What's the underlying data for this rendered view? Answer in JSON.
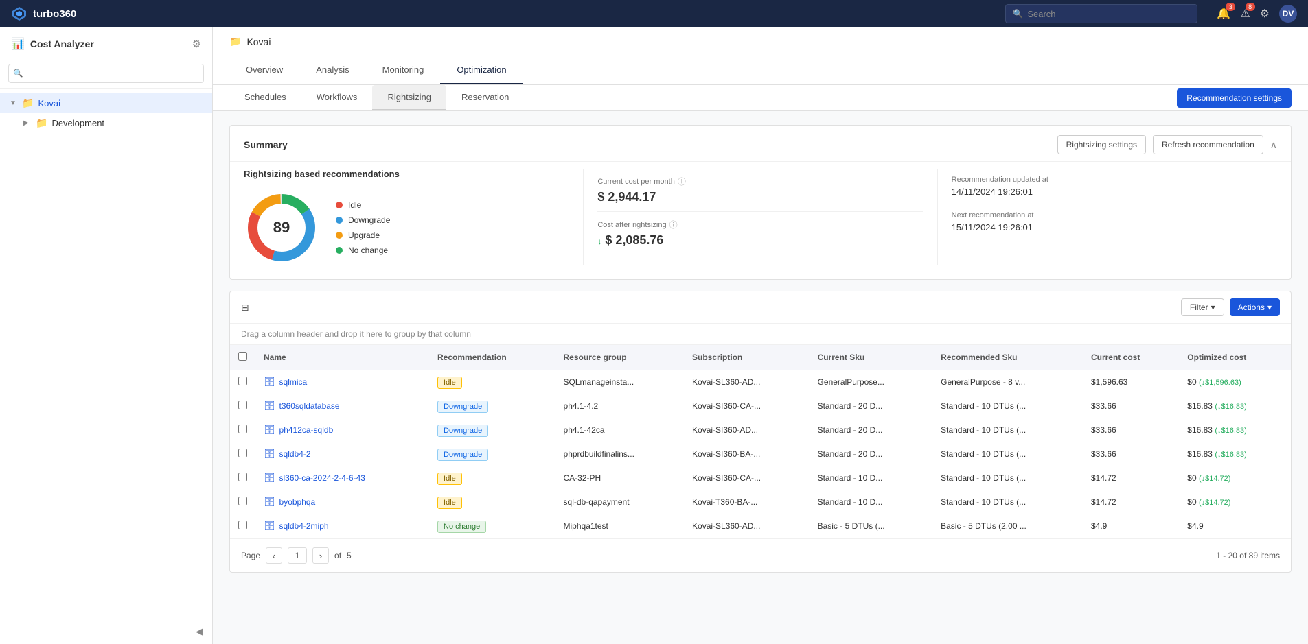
{
  "app": {
    "name": "turbo360",
    "logo_text": "turbo360"
  },
  "topnav": {
    "search_placeholder": "Search",
    "bell_badge": "8",
    "alert_badge": "3",
    "avatar_text": "DV"
  },
  "sidebar": {
    "title": "Cost Analyzer",
    "search_placeholder": "",
    "tree_items": [
      {
        "id": "kovai",
        "label": "Kovai",
        "level": 0,
        "active": true,
        "expanded": true
      },
      {
        "id": "development",
        "label": "Development",
        "level": 1,
        "active": false
      }
    ]
  },
  "page": {
    "breadcrumb": "Kovai",
    "tabs_primary": [
      {
        "id": "overview",
        "label": "Overview",
        "active": false
      },
      {
        "id": "analysis",
        "label": "Analysis",
        "active": false
      },
      {
        "id": "monitoring",
        "label": "Monitoring",
        "active": false
      },
      {
        "id": "optimization",
        "label": "Optimization",
        "active": true
      }
    ],
    "tabs_secondary": [
      {
        "id": "schedules",
        "label": "Schedules",
        "active": false
      },
      {
        "id": "workflows",
        "label": "Workflows",
        "active": false
      },
      {
        "id": "rightsizing",
        "label": "Rightsizing",
        "active": true
      },
      {
        "id": "reservation",
        "label": "Reservation",
        "active": false
      }
    ],
    "rec_settings_btn": "Recommendation settings"
  },
  "summary": {
    "title": "Summary",
    "btn_rightsizing": "Rightsizing settings",
    "btn_refresh": "Refresh recommendation",
    "chart": {
      "title": "Rightsizing based recommendations",
      "center_value": "89",
      "segments": [
        {
          "label": "Idle",
          "color": "#e74c3c",
          "value": 25
        },
        {
          "label": "Downgrade",
          "color": "#3498db",
          "value": 35
        },
        {
          "label": "Upgrade",
          "color": "#f39c12",
          "value": 15
        },
        {
          "label": "No change",
          "color": "#27ae60",
          "value": 14
        }
      ]
    },
    "stats": [
      {
        "label": "Current cost per month",
        "value": "$ 2,944.17",
        "arrow": "",
        "has_info": true
      },
      {
        "label": "Cost after rightsizing",
        "value": "$ 2,085.76",
        "arrow": "↓",
        "has_info": true
      }
    ],
    "rec_info": [
      {
        "label": "Recommendation updated at",
        "value": "14/11/2024 19:26:01"
      },
      {
        "label": "Next recommendation at",
        "value": "15/11/2024 19:26:01"
      }
    ]
  },
  "table": {
    "drag_hint": "Drag a column header and drop it here to group by that column",
    "filter_btn": "Filter",
    "actions_btn": "Actions",
    "columns": [
      "Name",
      "Recommendation",
      "Resource group",
      "Subscription",
      "Current Sku",
      "Recommended Sku",
      "Current cost",
      "Optimized cost"
    ],
    "rows": [
      {
        "name": "sqlmica",
        "recommendation": "Idle",
        "rec_type": "idle",
        "resource_group": "SQLmanageinsta...",
        "subscription": "Kovai-SL360-AD...",
        "current_sku": "GeneralPurpose...",
        "recommended_sku": "GeneralPurpose - 8 v...",
        "current_cost": "$1,596.63",
        "optimized_cost": "$0",
        "savings": "↓$1,596.63"
      },
      {
        "name": "t360sqldatabase",
        "recommendation": "Downgrade",
        "rec_type": "downgrade",
        "resource_group": "ph4.1-4.2",
        "subscription": "Kovai-SI360-CA-...",
        "current_sku": "Standard - 20 D...",
        "recommended_sku": "Standard - 10 DTUs (...",
        "current_cost": "$33.66",
        "optimized_cost": "$16.83",
        "savings": "↓$16.83"
      },
      {
        "name": "ph412ca-sqldb",
        "recommendation": "Downgrade",
        "rec_type": "downgrade",
        "resource_group": "ph4.1-42ca",
        "subscription": "Kovai-SI360-AD...",
        "current_sku": "Standard - 20 D...",
        "recommended_sku": "Standard - 10 DTUs (...",
        "current_cost": "$33.66",
        "optimized_cost": "$16.83",
        "savings": "↓$16.83"
      },
      {
        "name": "sqldb4-2",
        "recommendation": "Downgrade",
        "rec_type": "downgrade",
        "resource_group": "phprdbuildfinalins...",
        "subscription": "Kovai-SI360-BA-...",
        "current_sku": "Standard - 20 D...",
        "recommended_sku": "Standard - 10 DTUs (...",
        "current_cost": "$33.66",
        "optimized_cost": "$16.83",
        "savings": "↓$16.83"
      },
      {
        "name": "sl360-ca-2024-2-4-6-43",
        "recommendation": "Idle",
        "rec_type": "idle",
        "resource_group": "CA-32-PH",
        "subscription": "Kovai-SI360-CA-...",
        "current_sku": "Standard - 10 D...",
        "recommended_sku": "Standard - 10 DTUs (...",
        "current_cost": "$14.72",
        "optimized_cost": "$0",
        "savings": "↓$14.72"
      },
      {
        "name": "byobphqa",
        "recommendation": "Idle",
        "rec_type": "idle",
        "resource_group": "sql-db-qapayment",
        "subscription": "Kovai-T360-BA-...",
        "current_sku": "Standard - 10 D...",
        "recommended_sku": "Standard - 10 DTUs (...",
        "current_cost": "$14.72",
        "optimized_cost": "$0",
        "savings": "↓$14.72"
      },
      {
        "name": "sqldb4-2miph",
        "recommendation": "No change",
        "rec_type": "nochange",
        "resource_group": "Miphqa1test",
        "subscription": "Kovai-SL360-AD...",
        "current_sku": "Basic - 5 DTUs (...",
        "recommended_sku": "Basic - 5 DTUs (2.00 ...",
        "current_cost": "$4.9",
        "optimized_cost": "$4.9",
        "savings": ""
      }
    ],
    "pagination": {
      "page_label": "Page",
      "current_page": "1",
      "of_label": "of",
      "total_pages": "5",
      "items_info": "1 - 20 of 89 items"
    }
  }
}
